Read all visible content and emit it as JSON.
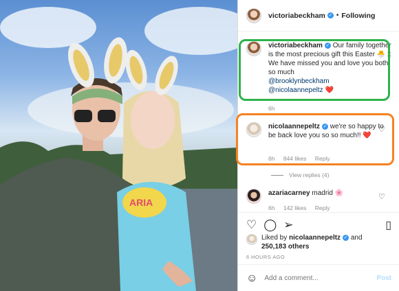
{
  "post": {
    "image_alt": "Couple wearing bunny ears outdoors",
    "author": "victoriabeckham",
    "separator": "•",
    "follow_label": "Following"
  },
  "caption": {
    "author": "victoriabeckham",
    "text": "Our family together is the most precious gift this Easter 🐣 x We have missed you and love you both so much",
    "mention1": "@brooklynbeckham",
    "mention2": "@nicolaannepeltz",
    "emoji_end": "❤️",
    "time": "6h"
  },
  "comments": [
    {
      "author": "nicolaannepeltz",
      "text": "we're so happy to be back love you so so much!!",
      "emoji": "❤️",
      "time": "6h",
      "likes": "844 likes",
      "reply_label": "Reply"
    },
    {
      "author": "azariacarney",
      "text": "madrid",
      "emoji": "🌸",
      "time": "6h",
      "likes": "142 likes",
      "reply_label": "Reply"
    }
  ],
  "view_replies": "View replies (4)",
  "actions": {
    "liked_prefix": "Liked by",
    "liked_user": "nicolaannepeltz",
    "liked_suffix": "and",
    "liked_count": "250,183 others",
    "time_ago": "6 HOURS AGO",
    "comment_placeholder": "Add a comment...",
    "post_label": "Post"
  },
  "icons": {
    "like": "heart-icon",
    "comment": "comment-icon",
    "share": "share-icon",
    "save": "bookmark-icon",
    "emoji": "smiley-icon",
    "more": "more-icon"
  },
  "colors": {
    "highlight_green": "#2db24b",
    "highlight_orange": "#f58220",
    "verified_blue": "#3897f0",
    "mention": "#00376b"
  }
}
